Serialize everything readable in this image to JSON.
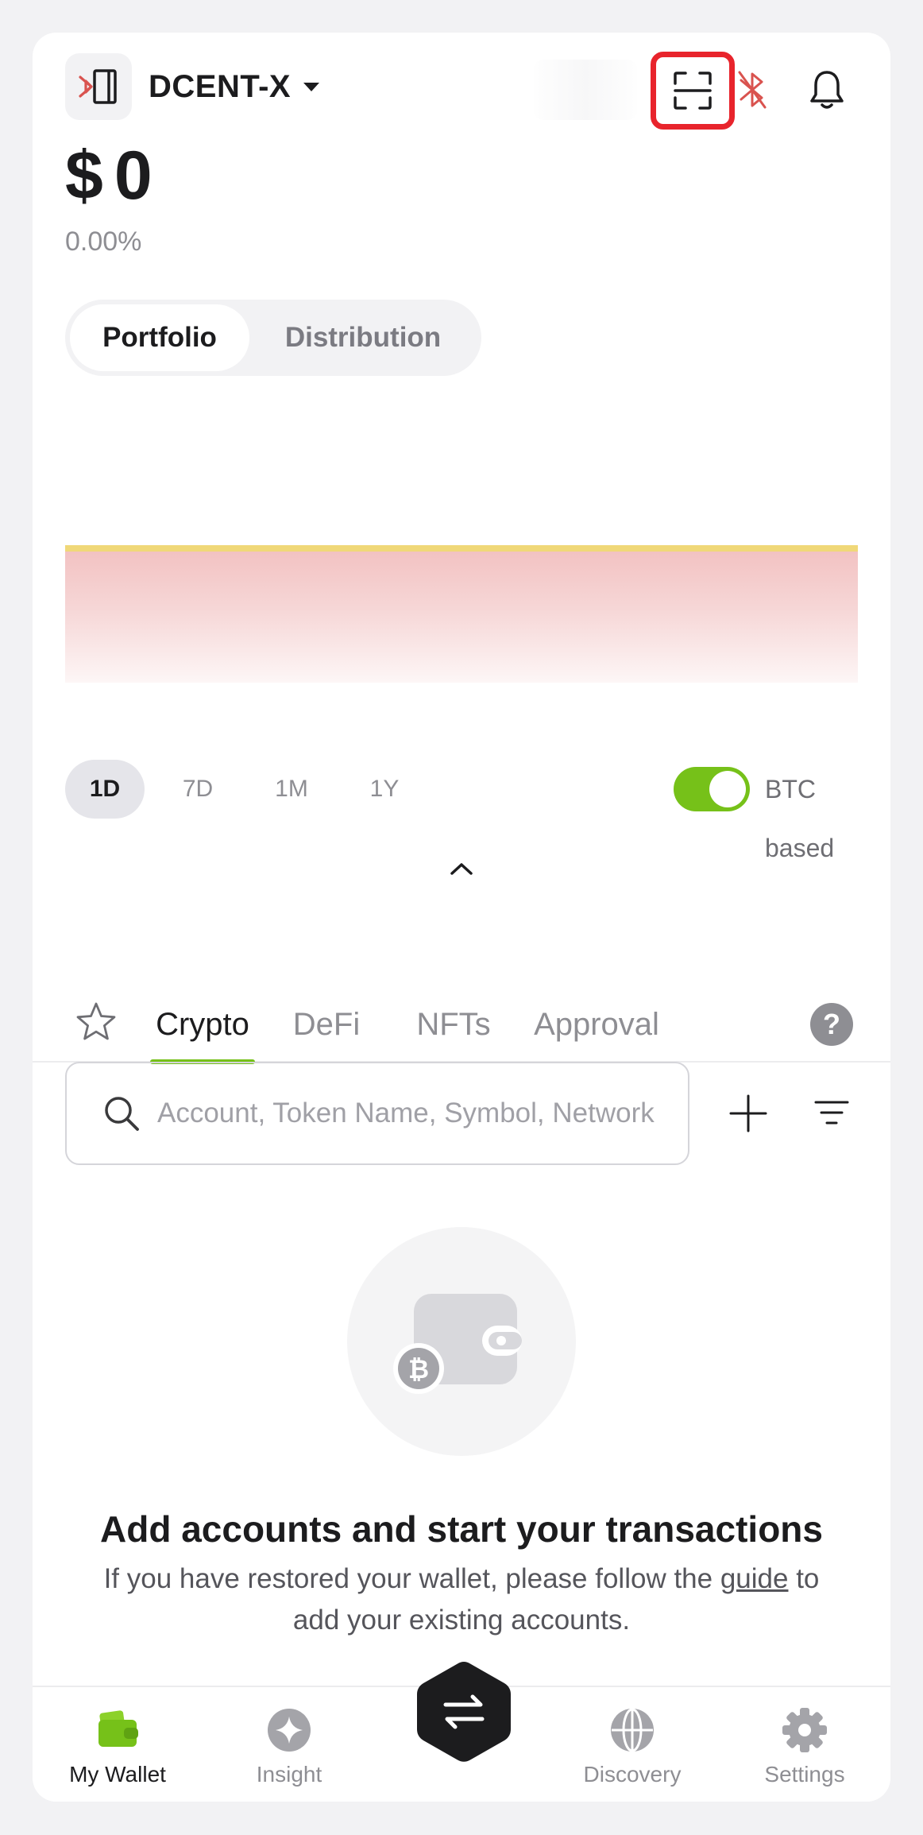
{
  "header": {
    "wallet_name": "DCENT-X",
    "device_icon": "hardware-wallet-bluetooth-icon",
    "scan_icon": "scan-qr-icon",
    "bluetooth_icon": "bluetooth-disconnected-icon",
    "notification_icon": "bell-icon"
  },
  "balance": {
    "currency_symbol": "$",
    "amount": "0",
    "change": "0.00%"
  },
  "view_tabs": {
    "portfolio": "Portfolio",
    "distribution": "Distribution"
  },
  "chart": {
    "line_color": "#f0d878",
    "fill_color": "#f2c1c1"
  },
  "periods": [
    "1D",
    "7D",
    "1M",
    "1Y"
  ],
  "selected_period": "1D",
  "btc_toggle": {
    "label": "BTC based",
    "enabled": true,
    "color": "#76c119"
  },
  "asset_tabs": {
    "crypto": "Crypto",
    "defi": "DeFi",
    "nfts": "NFTs",
    "approval": "Approval",
    "help": "?"
  },
  "search": {
    "placeholder": "Account, Token Name, Symbol, Network",
    "value": ""
  },
  "empty_state": {
    "title": "Add accounts and start your transactions",
    "desc_before": "If you have restored your wallet, please follow the ",
    "desc_link": "guide",
    "desc_after": " to add your existing accounts."
  },
  "bottom_nav": {
    "my_wallet": "My Wallet",
    "insight": "Insight",
    "discovery": "Discovery",
    "settings": "Settings",
    "swap_icon": "swap-arrows-icon"
  },
  "colors": {
    "accent": "#76c119",
    "alert": "#e8242c",
    "bluetooth": "#d9534f"
  }
}
